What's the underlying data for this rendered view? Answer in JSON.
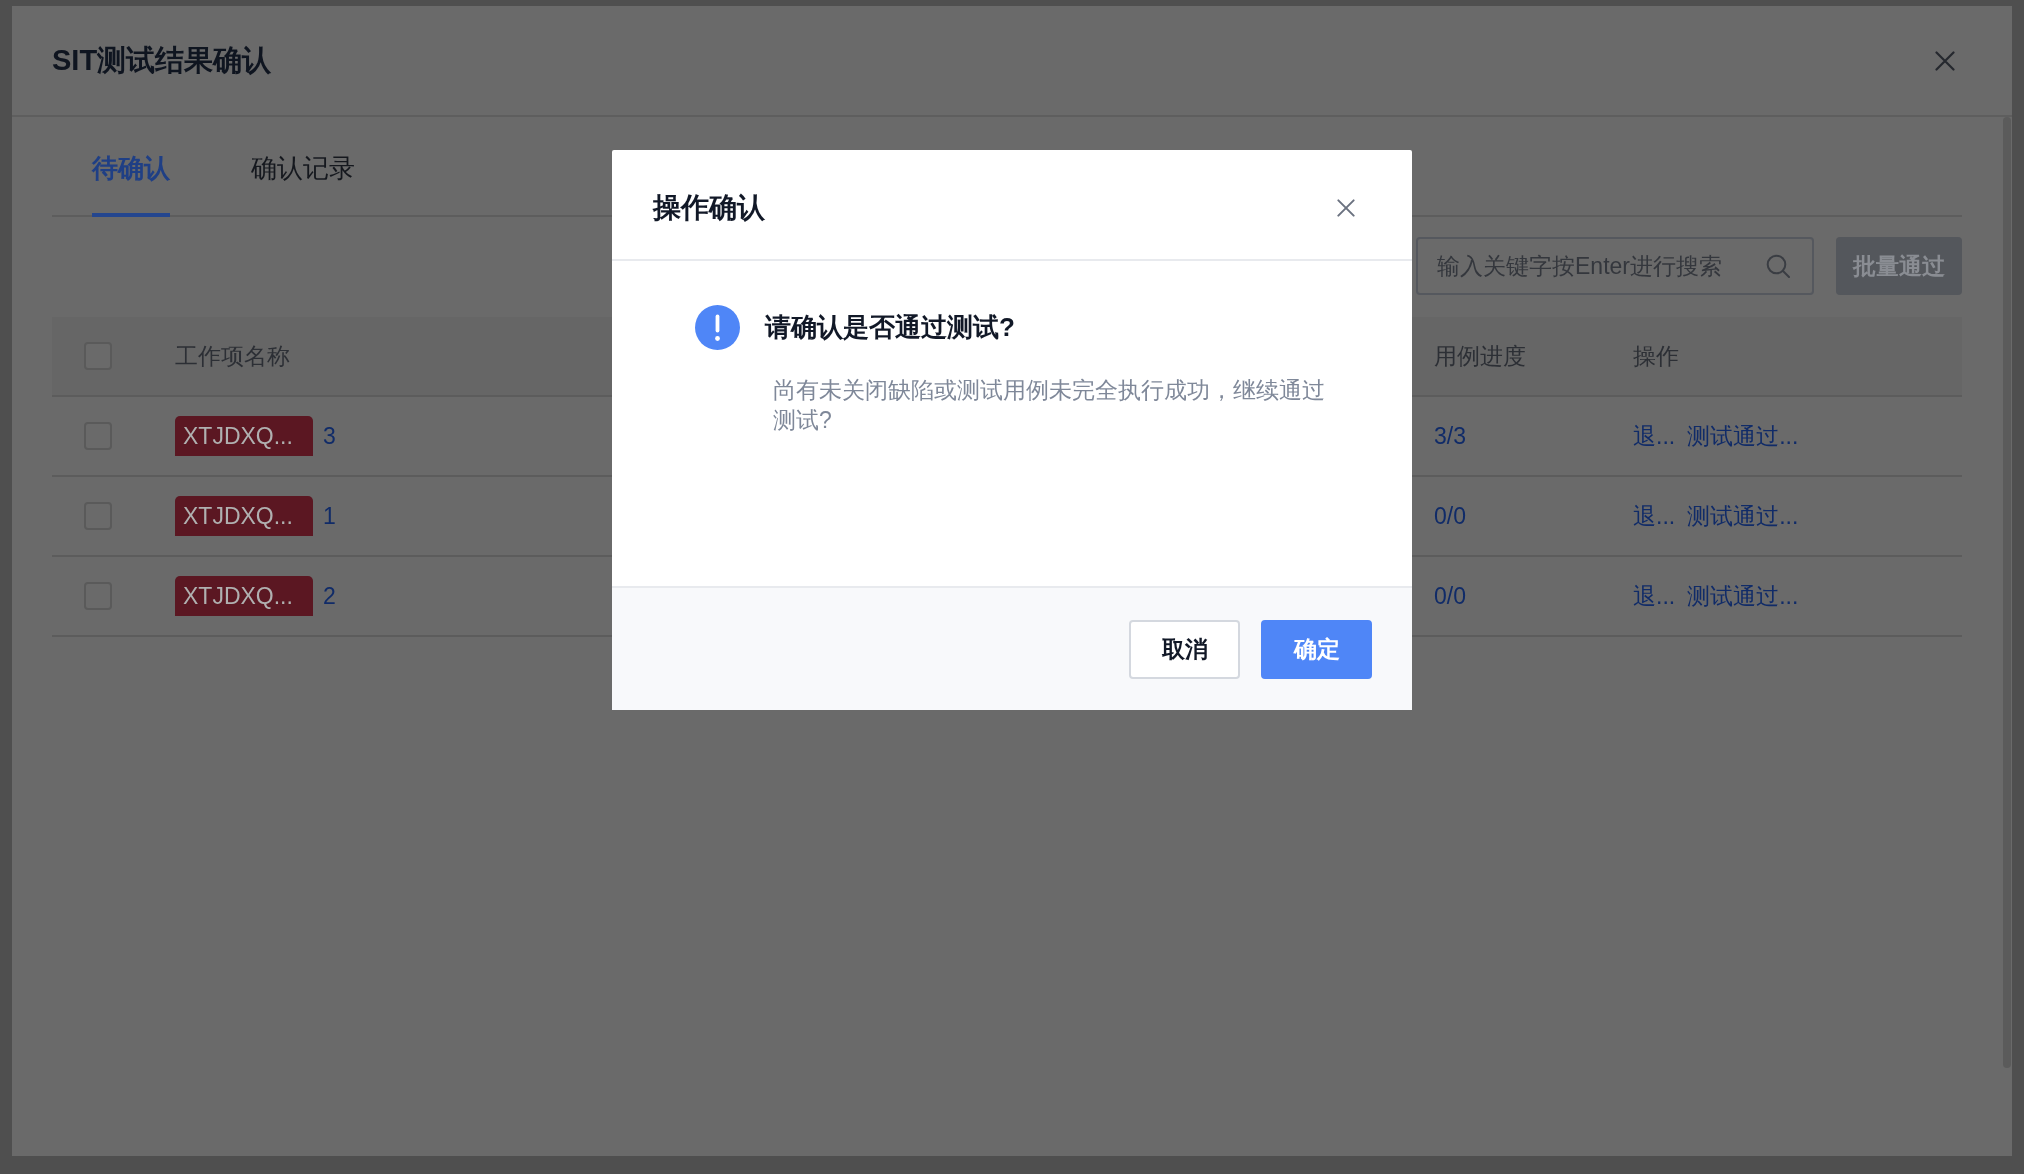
{
  "drawer": {
    "title": "SIT测试结果确认"
  },
  "tabs": [
    {
      "label": "待确认",
      "selected": true
    },
    {
      "label": "确认记录",
      "selected": false
    }
  ],
  "search": {
    "placeholder": "输入关键字按Enter进行搜索"
  },
  "batch_button": {
    "label": "批量通过",
    "disabled": true
  },
  "table": {
    "header_checkbox": {
      "checked": false
    },
    "columns": [
      "工作项名称",
      "用例进度",
      "操作"
    ],
    "rows": [
      {
        "checked": false,
        "tag": "XTJDXQ...",
        "name": "3",
        "progress": "3/3",
        "actions": [
          "退...",
          "测试通过..."
        ]
      },
      {
        "checked": false,
        "tag": "XTJDXQ...",
        "name": "1",
        "progress": "0/0",
        "actions": [
          "退...",
          "测试通过..."
        ]
      },
      {
        "checked": false,
        "tag": "XTJDXQ...",
        "name": "2",
        "progress": "0/0",
        "actions": [
          "退...",
          "测试通过..."
        ]
      }
    ]
  },
  "dialog": {
    "title": "操作确认",
    "question": "请确认是否通过测试?",
    "message": "尚有未关闭缺陷或测试用例未完全执行成功，继续通过测试?",
    "buttons": [
      {
        "label": "取消",
        "kind": "secondary"
      },
      {
        "label": "确定",
        "kind": "primary"
      }
    ]
  }
}
